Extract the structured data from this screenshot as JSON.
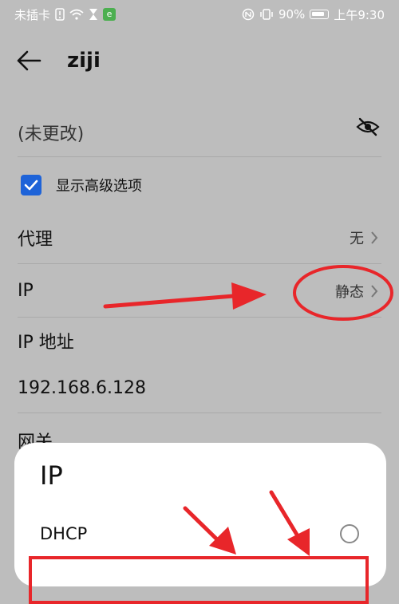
{
  "status_bar": {
    "left_text": "未插卡",
    "right_text": "90%",
    "time": "上午9:30",
    "sim_icon_label": "e"
  },
  "header": {
    "title": "ziji"
  },
  "password": {
    "placeholder": "(未更改)"
  },
  "advanced": {
    "label": "显示高级选项",
    "checked": true
  },
  "proxy": {
    "title": "代理",
    "value": "无"
  },
  "ip": {
    "title": "IP",
    "value": "静态"
  },
  "ip_address": {
    "title": "IP 地址",
    "value": "192.168.6.128"
  },
  "gateway": {
    "title": "网关"
  },
  "sheet": {
    "title": "IP",
    "option_dhcp": "DHCP"
  },
  "colors": {
    "accent": "#1e63d8",
    "annotation_red": "#e8262a"
  }
}
